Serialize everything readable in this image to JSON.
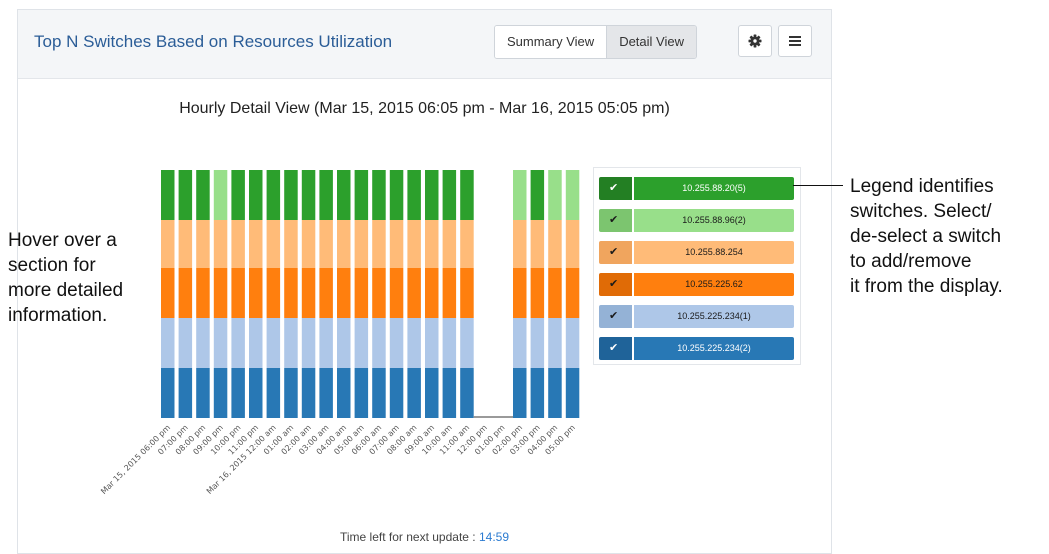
{
  "header": {
    "title": "Top N Switches Based on Resources Utilization",
    "summary_view_label": "Summary View",
    "detail_view_label": "Detail View",
    "settings_icon": "gear-icon",
    "menu_icon": "hamburger-menu-icon"
  },
  "chart": {
    "title": "Hourly Detail View (Mar 15, 2015 06:05 pm - Mar 16, 2015 05:05 pm)"
  },
  "chart_data": {
    "type": "bar",
    "stacked": true,
    "categories": [
      "Mar 15, 2015 06:00 pm",
      "07:00 pm",
      "08:00 pm",
      "09:00 pm",
      "10:00 pm",
      "11:00 pm",
      "Mar 16, 2015 12:00 am",
      "01:00 am",
      "02:00 am",
      "03:00 am",
      "04:00 am",
      "05:00 am",
      "06:00 am",
      "07:00 am",
      "08:00 am",
      "09:00 am",
      "10:00 am",
      "11:00 am",
      "12:00 pm",
      "01:00 pm",
      "02:00 pm",
      "03:00 pm",
      "04:00 pm",
      "05:00 pm"
    ],
    "present": [
      true,
      true,
      true,
      true,
      true,
      true,
      true,
      true,
      true,
      true,
      true,
      true,
      true,
      true,
      true,
      true,
      true,
      true,
      false,
      false,
      true,
      true,
      true,
      true
    ],
    "top_switch_per_bar": [
      "10.255.88.20(5)",
      "10.255.88.20(5)",
      "10.255.88.20(5)",
      "10.255.88.96(2)",
      "10.255.88.20(5)",
      "10.255.88.20(5)",
      "10.255.88.20(5)",
      "10.255.88.20(5)",
      "10.255.88.20(5)",
      "10.255.88.20(5)",
      "10.255.88.20(5)",
      "10.255.88.20(5)",
      "10.255.88.20(5)",
      "10.255.88.20(5)",
      "10.255.88.20(5)",
      "10.255.88.20(5)",
      "10.255.88.20(5)",
      "10.255.88.20(5)",
      null,
      null,
      "10.255.88.96(2)",
      "10.255.88.20(5)",
      "10.255.88.96(2)",
      "10.255.88.96(2)"
    ],
    "segments_bottom_to_top": [
      {
        "name": "10.255.225.234(2)",
        "color": "#2878b5"
      },
      {
        "name": "10.255.225.234(1)",
        "color": "#aec7e8"
      },
      {
        "name": "10.255.225.62",
        "color": "#ff7f0e"
      },
      {
        "name": "10.255.88.254",
        "color": "#ffbb78"
      },
      {
        "name": "top",
        "color": "#2ca02c"
      }
    ],
    "highlight_color": "#98df8a"
  },
  "legend": {
    "items": [
      {
        "label": "10.255.88.20(5)",
        "color": "#2ca02c",
        "check_color": "#237f23",
        "text_color": "#ffffff",
        "tick_color": "#ffffff"
      },
      {
        "label": "10.255.88.96(2)",
        "color": "#98df8a",
        "check_color": "#7cc56f",
        "text_color": "#1a1a1a",
        "tick_color": "#1a1a1a"
      },
      {
        "label": "10.255.88.254",
        "color": "#ffbb78",
        "check_color": "#f0a55e",
        "text_color": "#1a1a1a",
        "tick_color": "#1a1a1a"
      },
      {
        "label": "10.255.225.62",
        "color": "#ff7f0e",
        "check_color": "#e06b06",
        "text_color": "#1a1a1a",
        "tick_color": "#1a1a1a"
      },
      {
        "label": "10.255.225.234(1)",
        "color": "#aec7e8",
        "check_color": "#94b2d6",
        "text_color": "#1a1a1a",
        "tick_color": "#1a1a1a"
      },
      {
        "label": "10.255.225.234(2)",
        "color": "#2878b5",
        "check_color": "#1f6399",
        "text_color": "#ffffff",
        "tick_color": "#ffffff"
      }
    ],
    "check_glyph": "✔"
  },
  "footer": {
    "update_label": "Time left for next update : ",
    "update_time": "14:59"
  },
  "annotations": {
    "hover": "Hover over a\nsection for\nmore detailed\ninformation.",
    "legend": "Legend identifies\nswitches. Select/\nde-select a switch\nto add/remove\nit from the display."
  }
}
